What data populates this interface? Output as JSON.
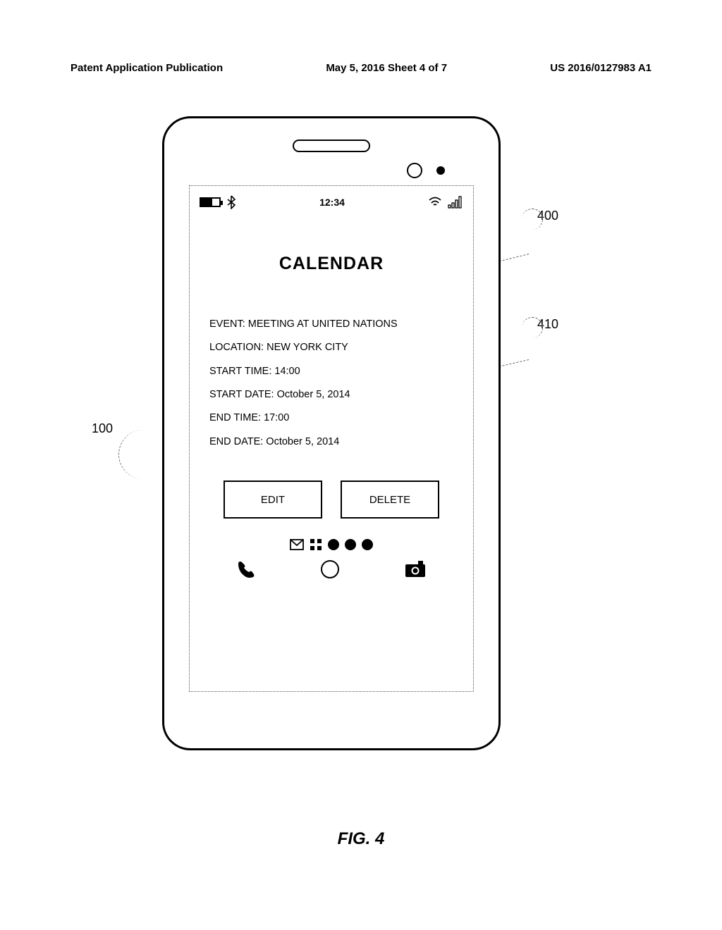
{
  "header": {
    "left": "Patent Application Publication",
    "center": "May 5, 2016  Sheet 4 of 7",
    "right": "US 2016/0127983 A1"
  },
  "statusbar": {
    "time": "12:34"
  },
  "app": {
    "title": "CALENDAR"
  },
  "event": {
    "line1": "EVENT: MEETING AT UNITED NATIONS",
    "line2": "LOCATION:  NEW YORK CITY",
    "line3": "START TIME: 14:00",
    "line4": "START DATE: October 5, 2014",
    "line5": "END TIME: 17:00",
    "line6": "END DATE: October 5, 2014"
  },
  "buttons": {
    "edit": "EDIT",
    "delete": "DELETE"
  },
  "callouts": {
    "c100": "100",
    "c400": "400",
    "c410": "410"
  },
  "figure": "FIG. 4"
}
